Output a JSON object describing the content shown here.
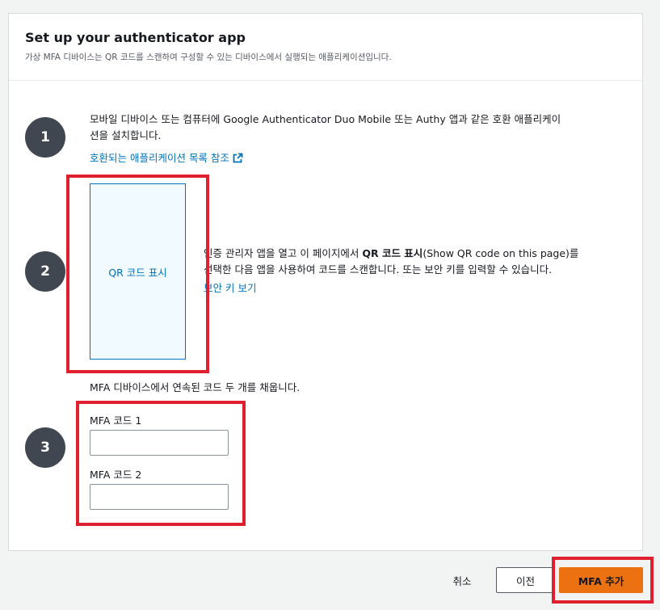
{
  "header": {
    "title": "Set up your authenticator app",
    "subtitle": "가상 MFA 디바이스는 QR 코드를 스캔하여 구성할 수 있는 디바이스에서 실행되는 애플리케이션입니다."
  },
  "steps": [
    {
      "number": "1",
      "text_line1": "모바일 디바이스 또는 컴퓨터에 Google Authenticator Duo Mobile 또는 Authy 앱과 같은 호환 애플리케이",
      "text_line2": "션을 설치합니다.",
      "link": "호환되는 애플리케이션 목록 참조",
      "link_icon": "external-link-icon"
    },
    {
      "number": "2",
      "qr_label": "QR 코드 표시",
      "text_line1_before": "인증 관리자 앱을 열고 이 페이지에서 ",
      "text_line1_bold": "QR 코드 표시",
      "text_line1_after": "(Show QR code on this page)를",
      "text_line2": "선택한 다음 앱을 사용하여 코드를 스캔합니다. 또는 보안 키를 입력할 수 있습니다.",
      "link": "보안 키 보기"
    },
    {
      "number": "3",
      "intro": "MFA 디바이스에서 연속된 코드 두 개를 채웁니다.",
      "code1_label": "MFA 코드 1",
      "code1_value": "",
      "code2_label": "MFA 코드 2",
      "code2_value": ""
    }
  ],
  "footer": {
    "cancel": "취소",
    "previous": "이전",
    "add_mfa": "MFA 추가"
  },
  "colors": {
    "accent": "#ec7211",
    "link": "#0073bb",
    "highlight": "#e0202e",
    "step_circle": "#414750"
  }
}
